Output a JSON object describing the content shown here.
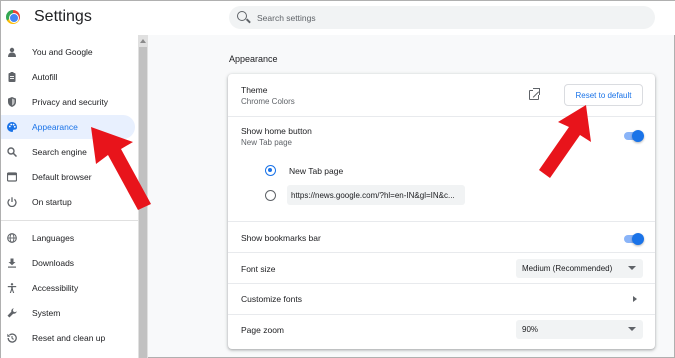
{
  "app": {
    "title": "Settings"
  },
  "search": {
    "placeholder": "Search settings"
  },
  "sidebar": {
    "items": [
      {
        "label": "You and Google",
        "icon": "person-icon",
        "active": false
      },
      {
        "label": "Autofill",
        "icon": "clipboard-icon",
        "active": false
      },
      {
        "label": "Privacy and security",
        "icon": "shield-icon",
        "active": false
      },
      {
        "label": "Appearance",
        "icon": "palette-icon",
        "active": true
      },
      {
        "label": "Search engine",
        "icon": "search-icon",
        "active": false
      },
      {
        "label": "Default browser",
        "icon": "browser-icon",
        "active": false
      },
      {
        "label": "On startup",
        "icon": "power-icon",
        "active": false
      },
      {
        "label": "Languages",
        "icon": "globe-icon",
        "active": false
      },
      {
        "label": "Downloads",
        "icon": "download-icon",
        "active": false
      },
      {
        "label": "Accessibility",
        "icon": "accessibility-icon",
        "active": false
      },
      {
        "label": "System",
        "icon": "wrench-icon",
        "active": false
      },
      {
        "label": "Reset and clean up",
        "icon": "history-icon",
        "active": false
      }
    ]
  },
  "main": {
    "section_title": "Appearance",
    "theme": {
      "label": "Theme",
      "value": "Chrome Colors",
      "reset_label": "Reset to default"
    },
    "home_button": {
      "label": "Show home button",
      "sublabel": "New Tab page",
      "enabled": true,
      "option_new_tab": "New Tab page",
      "option_url_value": "https://news.google.com/?hl=en-IN&gl=IN&c..."
    },
    "bookmarks_bar": {
      "label": "Show bookmarks bar",
      "enabled": true
    },
    "font_size": {
      "label": "Font size",
      "value": "Medium (Recommended)"
    },
    "customize_fonts": {
      "label": "Customize fonts"
    },
    "page_zoom": {
      "label": "Page zoom",
      "value": "90%"
    }
  },
  "colors": {
    "accent": "#1a73e8",
    "active_bg": "#e8f0fe",
    "annotation": "#e8141b"
  }
}
